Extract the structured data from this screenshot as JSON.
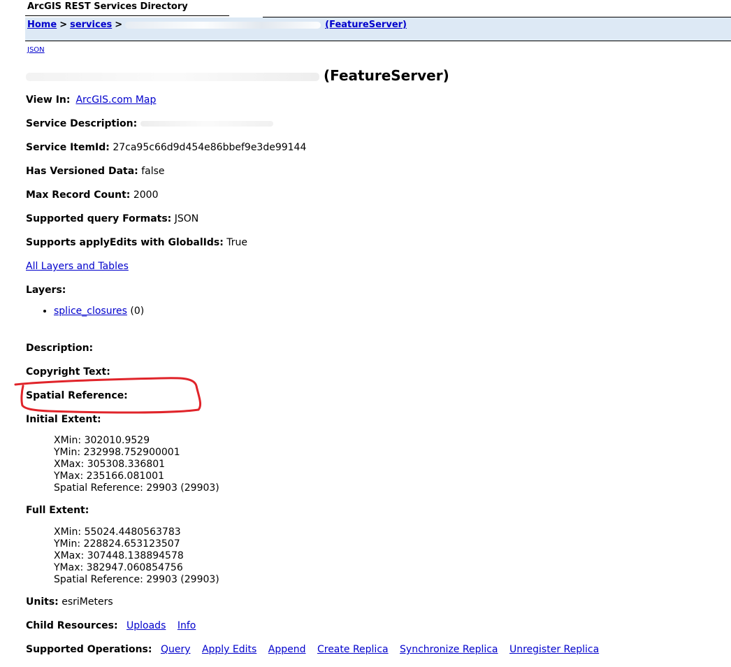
{
  "header": {
    "title": "ArcGIS REST Services Directory",
    "breadcrumb": {
      "home": "Home",
      "separator": ">",
      "services": "services",
      "service_suffix": "(FeatureServer)"
    },
    "json_link": "JSON"
  },
  "page": {
    "heading_suffix": "(FeatureServer)"
  },
  "props": {
    "view_in_label": "View In:",
    "view_in_link": "ArcGIS.com Map",
    "service_description_label": "Service Description:",
    "service_itemid_label": "Service ItemId:",
    "service_itemid_value": "27ca95c66d9d454e86bbef9e3de99144",
    "has_versioned_label": "Has Versioned Data:",
    "has_versioned_value": "false",
    "max_record_label": "Max Record Count:",
    "max_record_value": "2000",
    "query_formats_label": "Supported query Formats:",
    "query_formats_value": "JSON",
    "apply_edits_label": "Supports applyEdits with GlobalIds:",
    "apply_edits_value": "True",
    "all_layers_link": "All Layers and Tables",
    "layers_label": "Layers:",
    "description_label": "Description:",
    "copyright_label": "Copyright Text:",
    "spatial_ref_label": "Spatial Reference:",
    "initial_extent_label": "Initial Extent:",
    "full_extent_label": "Full Extent:",
    "units_label": "Units:",
    "units_value": "esriMeters",
    "child_resources_label": "Child Resources:",
    "supported_ops_label": "Supported Operations:"
  },
  "layers": [
    {
      "name": "splice_closures",
      "id": "(0)"
    }
  ],
  "initial_extent": {
    "xmin": "XMin: 302010.9529",
    "ymin": "YMin: 232998.752900001",
    "xmax": "XMax: 305308.336801",
    "ymax": "YMax: 235166.081001",
    "sr": "Spatial Reference: 29903 (29903)"
  },
  "full_extent": {
    "xmin": "XMin: 55024.4480563783",
    "ymin": "YMin: 228824.653123507",
    "xmax": "XMax: 307448.138894578",
    "ymax": "YMax: 382947.060854756",
    "sr": "Spatial Reference: 29903 (29903)"
  },
  "child_resources": [
    "Uploads",
    "Info"
  ],
  "operations": [
    "Query",
    "Apply Edits",
    "Append",
    "Create Replica",
    "Synchronize Replica",
    "Unregister Replica"
  ],
  "colors": {
    "link": "#0000cc",
    "breadcrumb_bg": "#dde9f5",
    "annotation": "#e0242a"
  }
}
